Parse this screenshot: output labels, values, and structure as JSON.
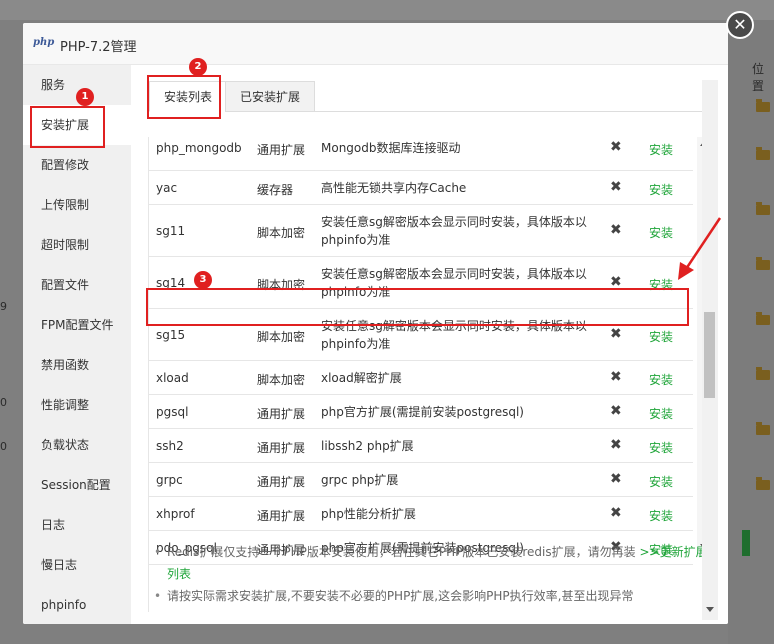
{
  "modal": {
    "title": "PHP-7.2管理",
    "logo": "php",
    "close": "✕"
  },
  "sidebar": {
    "items": [
      {
        "label": "服务"
      },
      {
        "label": "安装扩展"
      },
      {
        "label": "配置修改"
      },
      {
        "label": "上传限制"
      },
      {
        "label": "超时限制"
      },
      {
        "label": "配置文件"
      },
      {
        "label": "FPM配置文件"
      },
      {
        "label": "禁用函数"
      },
      {
        "label": "性能调整"
      },
      {
        "label": "负载状态"
      },
      {
        "label": "Session配置"
      },
      {
        "label": "日志"
      },
      {
        "label": "慢日志"
      },
      {
        "label": "phpinfo"
      }
    ],
    "active_index": 1
  },
  "tabs": [
    {
      "label": "安装列表"
    },
    {
      "label": "已安装扩展"
    }
  ],
  "table": {
    "rows": [
      {
        "name": "php_mongodb",
        "type": "通用扩展",
        "desc": "Mongodb数据库连接驱动",
        "action": "安装"
      },
      {
        "name": "yac",
        "type": "缓存器",
        "desc": "高性能无锁共享内存Cache",
        "action": "安装"
      },
      {
        "name": "sg11",
        "type": "脚本加密",
        "desc": "安装任意sg解密版本会显示同时安装，具体版本以phpinfo为准",
        "action": "安装"
      },
      {
        "name": "sg14",
        "type": "脚本加密",
        "desc": "安装任意sg解密版本会显示同时安装，具体版本以phpinfo为准",
        "action": "安装"
      },
      {
        "name": "sg15",
        "type": "脚本加密",
        "desc": "安装任意sg解密版本会显示同时安装，具体版本以phpinfo为准",
        "action": "安装"
      },
      {
        "name": "xload",
        "type": "脚本加密",
        "desc": "xload解密扩展",
        "action": "安装"
      },
      {
        "name": "pgsql",
        "type": "通用扩展",
        "desc": "php官方扩展(需提前安装postgresql)",
        "action": "安装"
      },
      {
        "name": "ssh2",
        "type": "通用扩展",
        "desc": "libssh2 php扩展",
        "action": "安装"
      },
      {
        "name": "grpc",
        "type": "通用扩展",
        "desc": "grpc php扩展",
        "action": "安装"
      },
      {
        "name": "xhprof",
        "type": "通用扩展",
        "desc": "php性能分析扩展",
        "action": "安装"
      },
      {
        "name": "pdo_pgsql",
        "type": "通用扩展",
        "desc": "php官方扩展(需提前安装postgresql)",
        "action": "安装"
      }
    ],
    "status_mark": "✖"
  },
  "notes": {
    "line1": "Redis扩展仅支持一个PHP版本安装使用，若在其它PHP版本已安装redis扩展，请勿再装",
    "line1_link": ">>更新扩展列表",
    "line2": "请按实际需求安装扩展,不要安装不必要的PHP扩展,这会影响PHP执行效率,甚至出现异常"
  },
  "annotations": {
    "badge1": "1",
    "badge2": "2",
    "badge3": "3"
  },
  "background": {
    "column_header": "位置",
    "left_num_a": "9",
    "left_num_b": "0",
    "left_num_c": "0"
  },
  "colors": {
    "accent": "#20a53a",
    "highlight": "#e02020"
  }
}
